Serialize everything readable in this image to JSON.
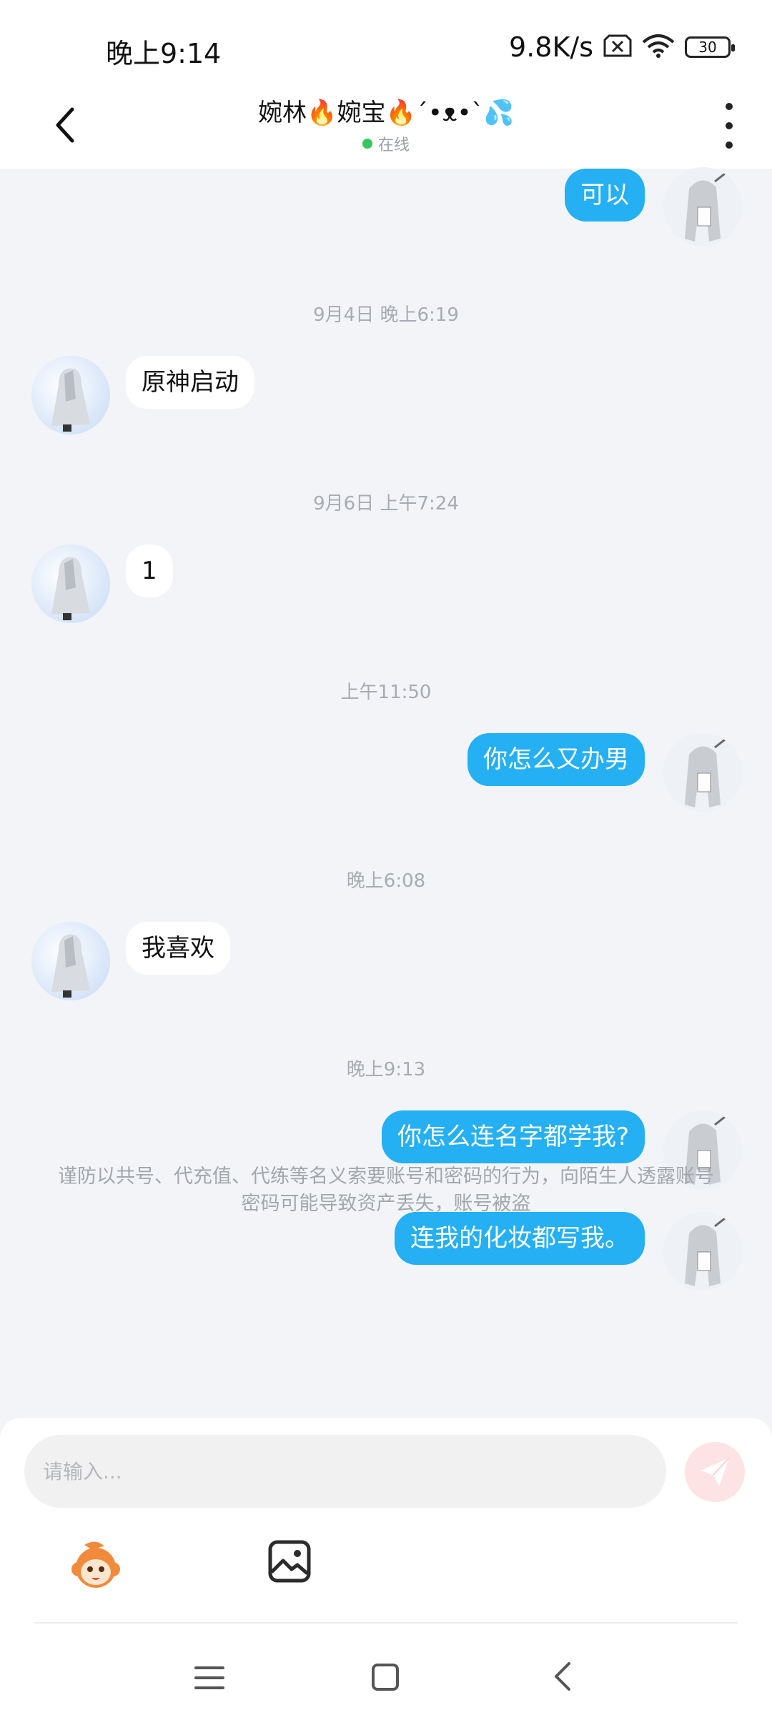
{
  "status": {
    "time": "晚上9:14",
    "net_speed": "9.8K/s",
    "battery": "30"
  },
  "header": {
    "title": "婉林🔥婉宝🔥´•ᴥ•`💦",
    "status": "在线"
  },
  "messages": [
    {
      "side": "out",
      "text": "可以"
    },
    {
      "type": "time",
      "text": "9月4日 晚上6:19"
    },
    {
      "side": "in",
      "text": "原神启动"
    },
    {
      "type": "time",
      "text": "9月6日 上午7:24"
    },
    {
      "side": "in",
      "text": "1"
    },
    {
      "type": "time",
      "text": "上午11:50"
    },
    {
      "side": "out",
      "text": "你怎么又办男"
    },
    {
      "type": "time",
      "text": "晚上6:08"
    },
    {
      "side": "in",
      "text": "我喜欢"
    },
    {
      "type": "time",
      "text": "晚上9:13"
    },
    {
      "side": "out",
      "text": "你怎么连名字都学我?"
    },
    {
      "side": "out",
      "text": "连我的化妆都写我。"
    }
  ],
  "notice": "谨防以共号、代充值、代练等名义索要账号和密码的行为，向陌生人透露账号密码可能导致资产丢失，账号被盗",
  "composer": {
    "placeholder": "请输入..."
  },
  "icons": {
    "back": "chevron-left-icon",
    "more": "more-vertical-icon",
    "send": "send-icon",
    "emoji": "monkey-emoji-icon",
    "image": "image-icon"
  },
  "colors": {
    "outgoing_bubble": "#24b0f2",
    "incoming_bubble": "#ffffff",
    "chat_background": "#f2f4f7",
    "online_dot": "#34c759",
    "send_button": "#fde3e3"
  }
}
